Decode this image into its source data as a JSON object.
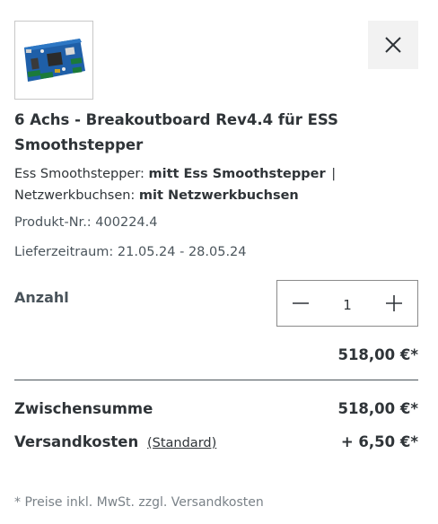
{
  "product": {
    "title": "6 Achs - Breakoutboard Rev4.4 für ESS Smoothstepper",
    "options": [
      {
        "label": "Ess Smoothstepper:",
        "value": "mitt Ess Smoothstepper",
        "separator": "|"
      },
      {
        "label": "Netzwerkbuchsen:",
        "value": "mit Netzwerkbuchsen"
      }
    ],
    "sku_label": "Produkt-Nr.:",
    "sku_value": "400224.4",
    "delivery_label": "Lieferzeitraum:",
    "delivery_value": "21.05.24 - 28.05.24",
    "image_icon": "circuit-board-image"
  },
  "quantity": {
    "label": "Anzahl",
    "value": "1",
    "decrement_icon": "minus-icon",
    "increment_icon": "plus-icon"
  },
  "line_total": "518,00 €*",
  "summary": {
    "subtotal_label": "Zwischensumme",
    "subtotal_value": "518,00 €*",
    "shipping_label": "Versandkosten",
    "shipping_method": "(Standard)",
    "shipping_value": "+ 6,50 €*"
  },
  "footnote": "* Preise inkl. MwSt. zzgl. Versandkosten",
  "colors": {
    "text_dark": "#2f3438",
    "text_muted": "#4a545b",
    "close_bg": "#f2f2f2",
    "board_blue": "#1f5fa8"
  }
}
